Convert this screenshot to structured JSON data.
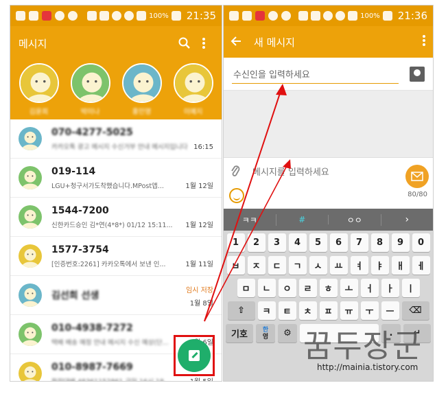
{
  "left": {
    "status": {
      "battery": "100%",
      "time": "21:35"
    },
    "title": "메시지",
    "favorites": [
      {
        "name": "김윤희",
        "color": "yellow"
      },
      {
        "name": "박미나",
        "color": "green"
      },
      {
        "name": "홍민영",
        "color": "blue"
      },
      {
        "name": "이예지",
        "color": "yellow"
      }
    ],
    "threads": [
      {
        "name": "070-4277-5025",
        "preview": "카카오톡 광고 메시지 수신거부 안내 메시지입니다",
        "time": "16:15",
        "color": "blue",
        "blur_name": true,
        "blur_preview": true
      },
      {
        "name": "019-114",
        "preview": "LGU+청구서가도착했습니다.MPost앱...",
        "time": "1월 12일",
        "color": "green"
      },
      {
        "name": "1544-7200",
        "preview": "신한카드승인 김*연(4*8*) 01/12 15:11...",
        "time": "1월 12일",
        "color": "green"
      },
      {
        "name": "1577-3754",
        "preview": "[인증번호:2261] 카카오톡에서 보낸 인...",
        "time": "1월 11일",
        "color": "yellow"
      },
      {
        "name": "김선희 선생",
        "preview": "",
        "time": "1월 8일",
        "draft": "임시 저장",
        "color": "blue",
        "blur_name": true
      },
      {
        "name": "010-4938-7272",
        "preview": "택배 배송 예정 안내 메시지 수신 예상(단...",
        "time": "1월 6일",
        "color": "green",
        "blur_name": true,
        "blur_preview": true
      },
      {
        "name": "010-8987-7669",
        "preview": "화장대배 48361152861 금일 16시 18...",
        "time": "1월 5일",
        "color": "yellow",
        "blur_name": true,
        "blur_preview": true
      }
    ]
  },
  "right": {
    "status": {
      "battery": "100%",
      "time": "21:36"
    },
    "title": "새 메시지",
    "recipient_placeholder": "수신인을 입력하세요",
    "message_placeholder": "메시지를 입력하세요",
    "char_count": "80/80",
    "suggestions": [
      "ㅋㅋ",
      "#",
      "ㅇㅇ"
    ],
    "keyboard": {
      "numbers": [
        "1",
        "2",
        "3",
        "4",
        "5",
        "6",
        "7",
        "8",
        "9",
        "0"
      ],
      "row1": [
        "ㅂ",
        "ㅈ",
        "ㄷ",
        "ㄱ",
        "ㅅ",
        "ㅛ",
        "ㅕ",
        "ㅑ",
        "ㅐ",
        "ㅔ"
      ],
      "row2": [
        "ㅁ",
        "ㄴ",
        "ㅇ",
        "ㄹ",
        "ㅎ",
        "ㅗ",
        "ㅓ",
        "ㅏ",
        "ㅣ"
      ],
      "row3": [
        "ㅋ",
        "ㅌ",
        "ㅊ",
        "ㅍ",
        "ㅠ",
        "ㅜ",
        "ㅡ"
      ],
      "symbol_key": "기호",
      "lang_key_top": "한",
      "lang_key_bottom": "영"
    }
  },
  "watermark": {
    "text": "꿈두장군",
    "url": "http://mainia.tistory.com"
  },
  "colors": {
    "accent": "#eda20a",
    "fab": "#1fae6b",
    "highlight": "#e01010"
  }
}
